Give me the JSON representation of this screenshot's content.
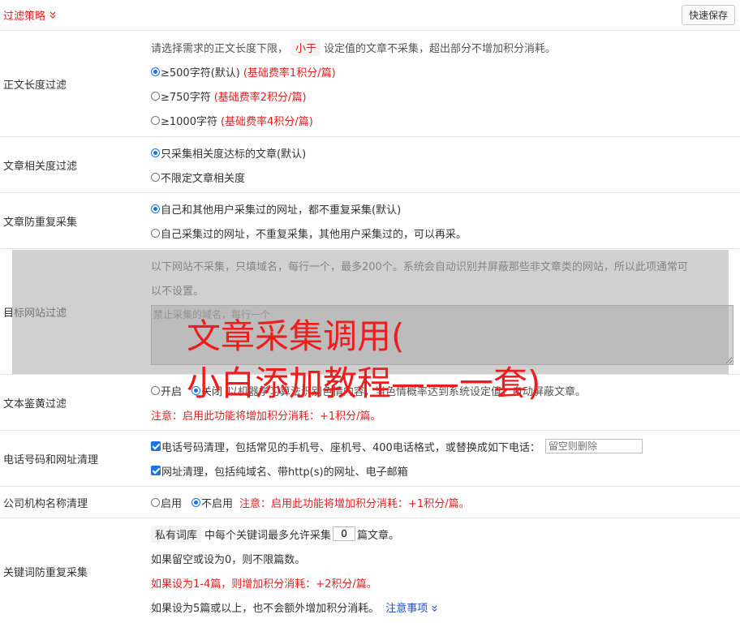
{
  "header": {
    "title": "过滤策略",
    "save_label": "快速保存"
  },
  "length_filter": {
    "label": "正文长度过滤",
    "desc_before": "请选择需求的正文长度下限，",
    "desc_tag": "小于",
    "desc_after": "设定值的文章不采集，超出部分不增加积分消耗。",
    "options": [
      {
        "text": "≥500字符(默认)",
        "note": "(基础费率1积分/篇)"
      },
      {
        "text": "≥750字符",
        "note": "(基础费率2积分/篇)"
      },
      {
        "text": "≥1000字符",
        "note": "(基础费率4积分/篇)"
      }
    ]
  },
  "relevance_filter": {
    "label": "文章相关度过滤",
    "options": [
      "只采集相关度达标的文章(默认)",
      "不限定文章相关度"
    ]
  },
  "dedup": {
    "label": "文章防重复采集",
    "options": [
      "自己和其他用户采集过的网址，都不重复采集(默认)",
      "自己采集过的网址，不重复采集，其他用户采集过的，可以再采。"
    ]
  },
  "site_filter": {
    "label": "目标网站过滤",
    "desc_line1": "以下网站不采集，只填域名，每行一个，最多200个。系统会自动识别并屏蔽那些非文章类的网站，所以此项通常可",
    "desc_line2": "以不设置。",
    "placeholder": "禁止采集的域名，每行一个"
  },
  "porn_filter": {
    "label": "文本鉴黄过滤",
    "opt_on": "开启",
    "opt_off": "关闭",
    "desc": "以机器学习算法识别色情内容，当色情概率达到系统设定值，自动屏蔽文章。",
    "note": "注意：启用此功能将增加积分消耗：+1积分/篇。"
  },
  "phone_cleanup": {
    "label": "电话号码和网址清理",
    "phone_text": "电话号码清理，包括常见的手机号、座机号、400电话格式，或替换成如下电话：",
    "phone_placeholder": "留空则删除",
    "url_text": "网址清理，包括纯域名、带http(s)的网址、电子邮箱"
  },
  "company_cleanup": {
    "label": "公司机构名称清理",
    "opt_on": "启用",
    "opt_off": "不启用",
    "note": "注意：启用此功能将增加积分消耗：+1积分/篇。"
  },
  "keyword_dedup": {
    "label": "关键词防重复采集",
    "tag": "私有词库",
    "text_before": "中每个关键词最多允许采集",
    "value": "0",
    "text_after": "篇文章。",
    "line2": "如果留空或设为0，则不限篇数。",
    "line3": "如果设为1-4篇，则增加积分消耗：+2积分/篇。",
    "line4": "如果设为5篇或以上，也不会额外增加积分消耗。",
    "notes_link": "注意事项"
  },
  "watermark": {
    "line1": "文章采集调用(",
    "line2": "小白添加教程——一套)"
  },
  "colors": {
    "accent": "#e02020",
    "radio": "#1a73e8",
    "link": "#1a50c8"
  }
}
